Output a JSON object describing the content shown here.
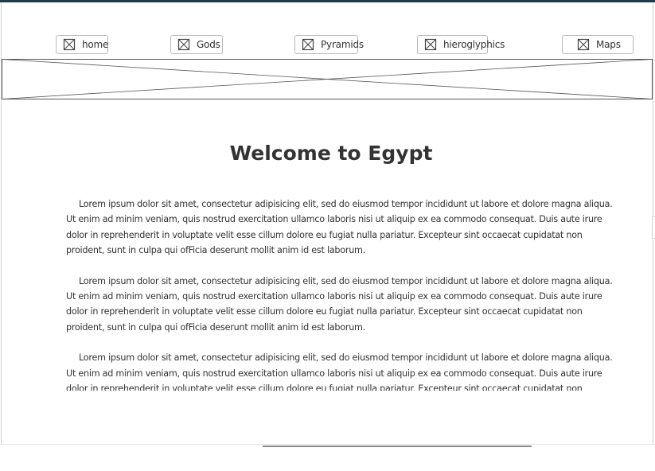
{
  "nav": {
    "items": [
      {
        "label": "home",
        "icon": "image-placeholder-icon"
      },
      {
        "label": "Gods",
        "icon": "image-placeholder-icon"
      },
      {
        "label": "Pyramids",
        "icon": "image-placeholder-icon"
      },
      {
        "label": "hieroglyphics",
        "icon": "image-placeholder-icon"
      },
      {
        "label": "Maps",
        "icon": "image-placeholder-icon"
      }
    ]
  },
  "page": {
    "title": "Welcome to Egypt",
    "paragraphs": [
      "Lorem ipsum dolor sit amet, consectetur adipisicing elit, sed do eiusmod tempor incididunt ut labore et dolore magna aliqua. Ut enim ad minim veniam, quis nostrud exercitation ullamco laboris nisi ut aliquip ex ea commodo consequat. Duis aute irure dolor in reprehenderit in voluptate velit esse cillum dolore eu fugiat nulla pariatur. Excepteur sint occaecat cupidatat non proident, sunt in culpa qui ofFicia deserunt mollit anim id est laborum.",
      "Lorem ipsum dolor sit amet, consectetur adipisicing elit, sed do eiusmod tempor incididunt ut labore et dolore magna aliqua. Ut enim ad minim veniam, quis nostrud exercitation ullamco laboris nisi ut aliquip ex ea commodo consequat. Duis aute irure dolor in reprehenderit in voluptate velit esse cillum dolore eu fugiat nulla pariatur. Excepteur sint occaecat cupidatat non proident, sunt in culpa qui ofFicia deserunt mollit anim id est laborum.",
      "Lorem ipsum dolor sit amet, consectetur adipisicing elit, sed do eiusmod tempor incididunt ut labore et dolore magna aliqua. Ut enim ad minim veniam, quis nostrud exercitation ullamco laboris nisi ut aliquip ex ea commodo consequat. Duis aute irure dolor in reprehenderit in voluptate velit esse cillum dolore eu fugiat nulla pariatur. Excepteur sint occaecat cupidatat non proident, sunt in culpa qui ofFicia deserunt mollit anim id est laborum."
    ]
  },
  "banner": {
    "icon": "image-placeholder-icon"
  },
  "colors": {
    "topbar": "#1f3a4d",
    "text": "#333333",
    "border": "#b9b9b9"
  }
}
